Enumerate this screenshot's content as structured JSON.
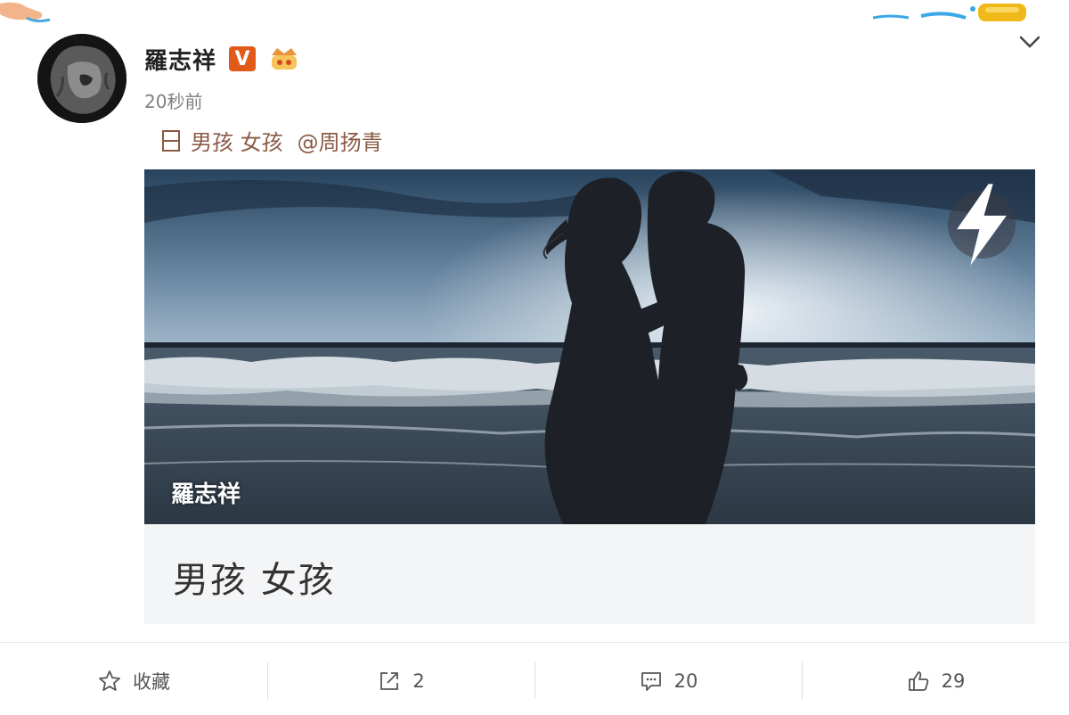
{
  "author": {
    "name": "羅志祥",
    "verified_badge": "V",
    "avatar_icon": "lion-avatar"
  },
  "post": {
    "timestamp": "20秒前",
    "text": "男孩 女孩",
    "mention": "@周扬青",
    "link_icon": "article-icon"
  },
  "card": {
    "watermark": "羅志祥",
    "title": "男孩 女孩",
    "overlay_icon": "lightning-icon"
  },
  "actions": {
    "favorite_label": "收藏",
    "repost_count": "2",
    "comment_count": "20",
    "like_count": "29"
  },
  "colors": {
    "accent_link": "#8a5a45",
    "verified_badge": "#e05a1a",
    "text_muted": "#808080"
  }
}
